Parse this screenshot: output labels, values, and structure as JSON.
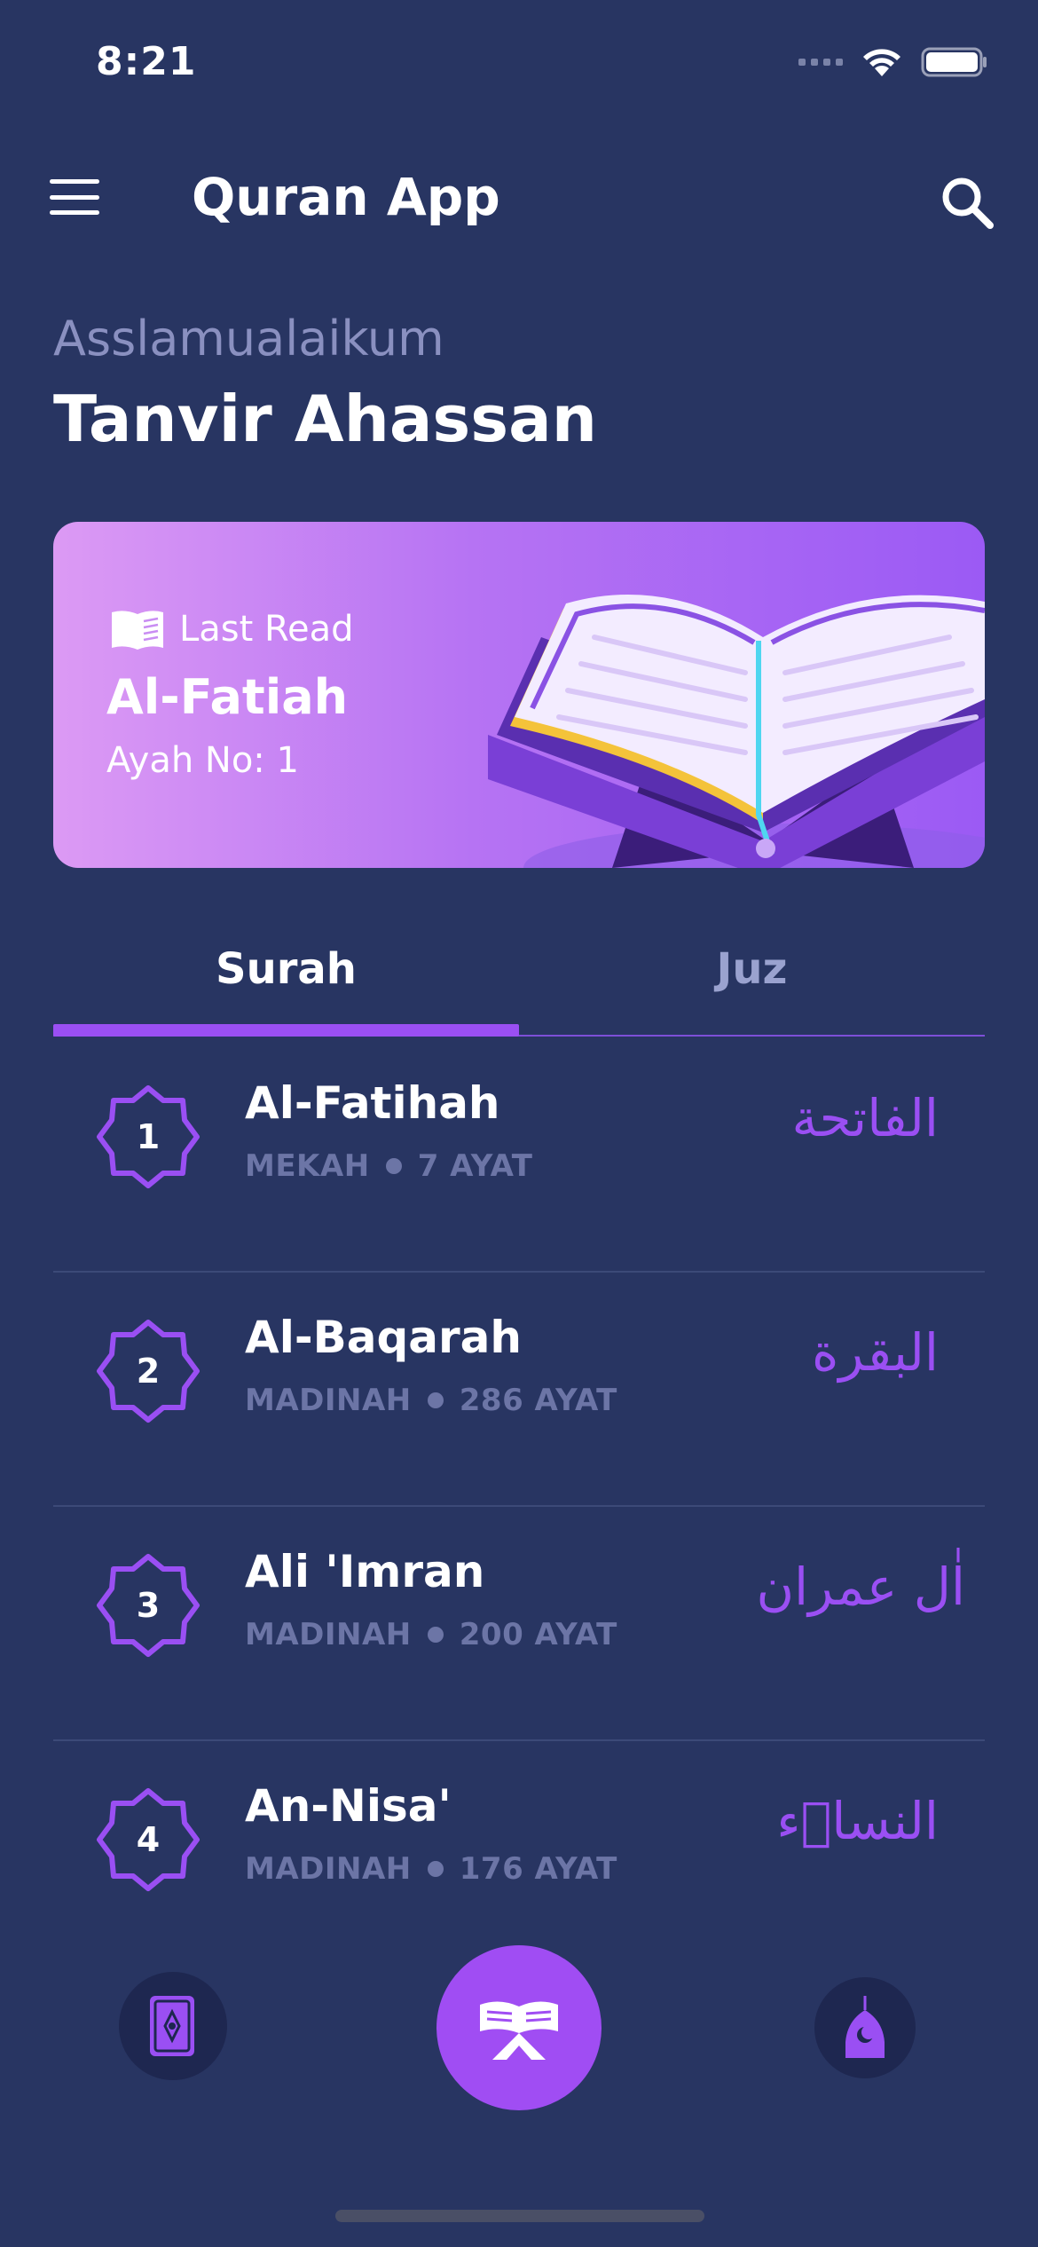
{
  "status_bar": {
    "time": "8:21"
  },
  "header": {
    "title": "Quran App"
  },
  "greeting": {
    "salutation": "Asslamualaikum",
    "name": "Tanvir Ahassan"
  },
  "last_read": {
    "label": "Last Read",
    "surah": "Al-Fatiah",
    "ayah": "Ayah No: 1"
  },
  "tabs": [
    {
      "label": "Surah",
      "active": true
    },
    {
      "label": "Juz",
      "active": false
    }
  ],
  "surahs": [
    {
      "number": "1",
      "name": "Al-Fatihah",
      "place": "MEKAH",
      "ayat": "7 AYAT",
      "arabic": "الفاتحة"
    },
    {
      "number": "2",
      "name": "Al-Baqarah",
      "place": "MADINAH",
      "ayat": "286 AYAT",
      "arabic": "البقرة"
    },
    {
      "number": "3",
      "name": "Ali 'Imran",
      "place": "MADINAH",
      "ayat": "200 AYAT",
      "arabic": "اٰل عمران"
    },
    {
      "number": "4",
      "name": "An-Nisa'",
      "place": "MADINAH",
      "ayat": "176 AYAT",
      "arabic": "النساۤء"
    }
  ],
  "colors": {
    "background": "#283562",
    "accent": "#9a4ff3",
    "muted": "#6c75a6"
  },
  "icons": {
    "menu": "menu-icon",
    "search": "search-icon",
    "book": "book-icon",
    "nav_left": "quran-book-icon",
    "nav_center": "open-quran-icon",
    "nav_right": "mosque-icon"
  }
}
